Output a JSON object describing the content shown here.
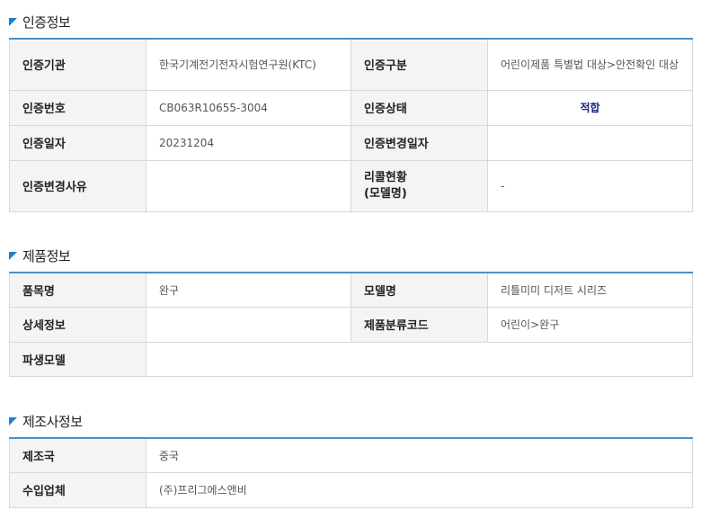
{
  "certification": {
    "title": "인증정보",
    "agency_label": "인증기관",
    "agency_value": "한국기계전기전자시험연구원(KTC)",
    "category_label": "인증구분",
    "category_value": "어린이제품 특별법 대상>안전확인 대상",
    "number_label": "인증번호",
    "number_value": "CB063R10655-3004",
    "status_label": "인증상태",
    "status_value": "적합",
    "date_label": "인증일자",
    "date_value": "20231204",
    "change_date_label": "인증변경일자",
    "change_date_value": "",
    "change_reason_label": "인증변경사유",
    "change_reason_value": "",
    "recall_label_line1": "리콜현황",
    "recall_label_line2": "(모델명)",
    "recall_value": "-"
  },
  "product": {
    "title": "제품정보",
    "item_label": "품목명",
    "item_value": "완구",
    "model_label": "모델명",
    "model_value": "리틀미미 디저트 시리즈",
    "detail_label": "상세정보",
    "detail_value": "",
    "class_code_label": "제품분류코드",
    "class_code_value": "어린이>완구",
    "derived_label": "파생모델",
    "derived_value": ""
  },
  "manufacturer": {
    "title": "제조사정보",
    "country_label": "제조국",
    "country_value": "중국",
    "importer_label": "수입업체",
    "importer_value": "(주)프리그에스앤비"
  },
  "colors": {
    "accent": "#1b7fd0",
    "header_border": "#4a90c8",
    "label_bg": "#f4f4f4",
    "status_text": "#1a237e"
  }
}
